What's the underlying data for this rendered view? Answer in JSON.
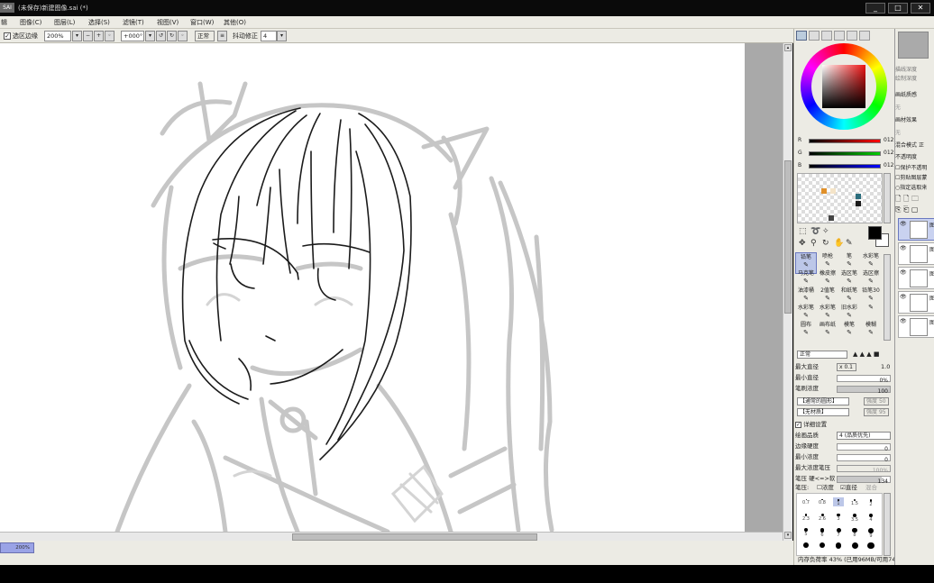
{
  "window": {
    "title": "(未保存)新建图像.sai (*)",
    "logo": "SAI"
  },
  "menu": [
    "图像(C)",
    "图层(L)",
    "选择(S)",
    "滤镜(T)",
    "视图(V)",
    "窗口(W)",
    "其他(O)"
  ],
  "menu_prefix": "辑",
  "toolbar": {
    "selection_edge_label": "选区边缘",
    "selection_edge_checked": true,
    "zoom": "200%",
    "angle": "+000°",
    "blend_mode": "正常",
    "stabilizer_label": "抖动修正",
    "stabilizer_value": "4"
  },
  "status": {
    "zoom": "200%"
  },
  "color": {
    "r_label": "R",
    "r_value": "012",
    "g_label": "G",
    "g_value": "012",
    "b_label": "B",
    "b_value": "012",
    "foreground": "#000000",
    "swatches": [
      "#e0902a",
      "#f4e4c8",
      "#2a6c7c",
      "#1a1a1a",
      "#444444"
    ]
  },
  "brushes": [
    {
      "label": "铅笔",
      "selected": true
    },
    {
      "label": "喷枪",
      "selected": false
    },
    {
      "label": "笔",
      "selected": false
    },
    {
      "label": "水彩笔",
      "selected": false
    },
    {
      "label": "马克笔",
      "selected": false
    },
    {
      "label": "橡皮擦",
      "selected": false
    },
    {
      "label": "选区笔",
      "selected": false
    },
    {
      "label": "选区擦",
      "selected": false
    },
    {
      "label": "油漆桶",
      "selected": false
    },
    {
      "label": "2值笔",
      "selected": false
    },
    {
      "label": "和纸笔",
      "selected": false
    },
    {
      "label": "铅笔30",
      "selected": false
    },
    {
      "label": "水彩笔",
      "selected": false
    },
    {
      "label": "水彩笔",
      "selected": false
    },
    {
      "label": "旧水彩",
      "selected": false
    },
    {
      "label": "",
      "selected": false
    },
    {
      "label": "圆布",
      "selected": false
    },
    {
      "label": "画布纸",
      "selected": false
    },
    {
      "label": "模笔",
      "selected": false
    },
    {
      "label": "模糊",
      "selected": false
    }
  ],
  "brush_settings": {
    "mode": "正常",
    "max_size_label": "最大直径",
    "max_size_mult": "x 0.1",
    "max_size_value": "1.0",
    "min_size_label": "最小直径",
    "min_size_value": "0%",
    "density_label": "笔刷浓度",
    "density_value": "100",
    "shape": "【通常的圆形】",
    "texture": "【无材质】",
    "shape_strength": "强度",
    "shape_strength_value": "50",
    "texture_strength": "强度",
    "texture_strength_value": "95",
    "detail_label": "详细设置",
    "detail_checked": true,
    "quality_label": "绘画品质",
    "quality_value": "4 (品质优先)",
    "edge_label": "边缘硬度",
    "edge_value": "0",
    "min_density_label": "最小浓度",
    "min_density_value": "0",
    "max_density_label": "最大浓度笔压",
    "max_density_value": "100%",
    "pressure_label": "笔压  硬<=>软",
    "pressure_value": "134",
    "pressure2_label": "笔压:",
    "pressure_density": "浓度",
    "pressure_size": "直径",
    "pressure_blend": "混合"
  },
  "brush_sizes": [
    "0.7",
    "0.8",
    "1",
    "1.5",
    "2",
    "2.3",
    "2.6",
    "3",
    "3.5",
    "4",
    "5",
    "6",
    "7",
    "8",
    "9",
    "",
    "",
    "",
    "",
    ""
  ],
  "memory": "内存负荷率 43% (已用96MB/可用749MB)",
  "layer_panel": {
    "blend_label": "混合模式",
    "blend_value": "正",
    "opacity_label": "不透明度",
    "protect": "保护不透明",
    "clip": "剪贴图层蒙",
    "select_src": "指定选取来",
    "paper_label": "画纸质感",
    "paper_value": "无",
    "material_label": "画材效果",
    "material_value": "无",
    "misc1": "描线深度",
    "misc2": "绘制深度",
    "layer_labels": [
      "图",
      "图",
      "图",
      "图",
      "图"
    ]
  }
}
